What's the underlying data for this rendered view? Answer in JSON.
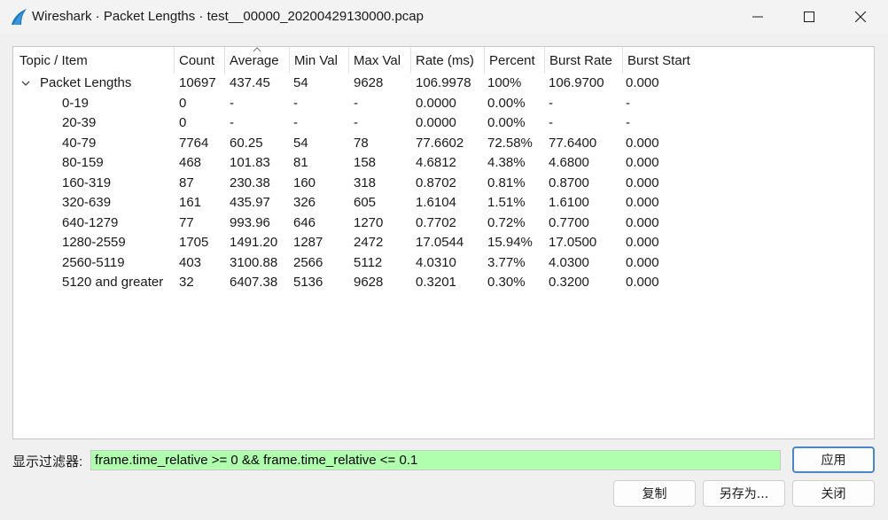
{
  "window": {
    "title": "Wireshark · Packet Lengths · test__00000_20200429130000.pcap",
    "colors": {
      "filter_bg": "#afffaf",
      "accent": "#4a86c8",
      "app_icon": "#1679c1"
    }
  },
  "columns": [
    "Topic / Item",
    "Count",
    "Average",
    "Min Val",
    "Max Val",
    "Rate (ms)",
    "Percent",
    "Burst Rate",
    "Burst Start"
  ],
  "sort_indicator": "up-caret-on-average",
  "parent": {
    "name": "Packet Lengths",
    "count": "10697",
    "average": "437.45",
    "min": "54",
    "max": "9628",
    "rate": "106.9978",
    "percent": "100%",
    "burst_rate": "106.9700",
    "burst_start": "0.000"
  },
  "rows": [
    {
      "name": "0-19",
      "count": "0",
      "average": "-",
      "min": "-",
      "max": "-",
      "rate": "0.0000",
      "percent": "0.00%",
      "burst_rate": "-",
      "burst_start": "-"
    },
    {
      "name": "20-39",
      "count": "0",
      "average": "-",
      "min": "-",
      "max": "-",
      "rate": "0.0000",
      "percent": "0.00%",
      "burst_rate": "-",
      "burst_start": "-"
    },
    {
      "name": "40-79",
      "count": "7764",
      "average": "60.25",
      "min": "54",
      "max": "78",
      "rate": "77.6602",
      "percent": "72.58%",
      "burst_rate": "77.6400",
      "burst_start": "0.000"
    },
    {
      "name": "80-159",
      "count": "468",
      "average": "101.83",
      "min": "81",
      "max": "158",
      "rate": "4.6812",
      "percent": "4.38%",
      "burst_rate": "4.6800",
      "burst_start": "0.000"
    },
    {
      "name": "160-319",
      "count": "87",
      "average": "230.38",
      "min": "160",
      "max": "318",
      "rate": "0.8702",
      "percent": "0.81%",
      "burst_rate": "0.8700",
      "burst_start": "0.000"
    },
    {
      "name": "320-639",
      "count": "161",
      "average": "435.97",
      "min": "326",
      "max": "605",
      "rate": "1.6104",
      "percent": "1.51%",
      "burst_rate": "1.6100",
      "burst_start": "0.000"
    },
    {
      "name": "640-1279",
      "count": "77",
      "average": "993.96",
      "min": "646",
      "max": "1270",
      "rate": "0.7702",
      "percent": "0.72%",
      "burst_rate": "0.7700",
      "burst_start": "0.000"
    },
    {
      "name": "1280-2559",
      "count": "1705",
      "average": "1491.20",
      "min": "1287",
      "max": "2472",
      "rate": "17.0544",
      "percent": "15.94%",
      "burst_rate": "17.0500",
      "burst_start": "0.000"
    },
    {
      "name": "2560-5119",
      "count": "403",
      "average": "3100.88",
      "min": "2566",
      "max": "5112",
      "rate": "4.0310",
      "percent": "3.77%",
      "burst_rate": "4.0300",
      "burst_start": "0.000"
    },
    {
      "name": "5120 and greater",
      "count": "32",
      "average": "6407.38",
      "min": "5136",
      "max": "9628",
      "rate": "0.3201",
      "percent": "0.30%",
      "burst_rate": "0.3200",
      "burst_start": "0.000"
    }
  ],
  "filter": {
    "label": "显示过滤器:",
    "value": "frame.time_relative >= 0 && frame.time_relative <= 0.1"
  },
  "buttons": {
    "apply": "应用",
    "copy": "复制",
    "save_as": "另存为...",
    "close": "关闭"
  }
}
